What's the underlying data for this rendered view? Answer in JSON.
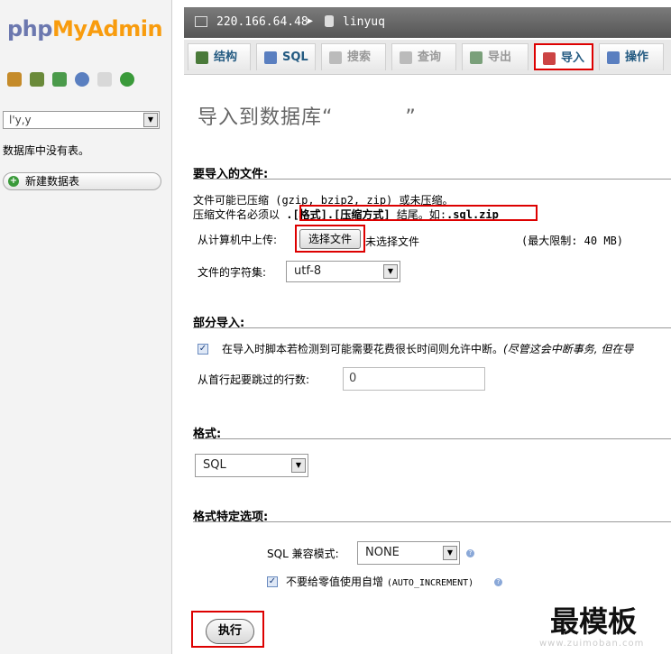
{
  "logo": {
    "part1": "php",
    "part2": "MyAdmin"
  },
  "sidebar": {
    "icons": [
      {
        "name": "home-icon",
        "color": "#c58b2a"
      },
      {
        "name": "sql-query-icon",
        "color": "#6a8a3a"
      },
      {
        "name": "exit-icon",
        "color": "#4a9a4a"
      },
      {
        "name": "help-icon",
        "color": "#5a7fc0"
      },
      {
        "name": "docs-icon",
        "color": "#c8c8c8"
      },
      {
        "name": "reload-icon",
        "color": "#3a9a3a"
      }
    ],
    "db_selected": "l'y,y",
    "no_tables": "数据库中没有表。",
    "new_table": "新建数据表"
  },
  "breadcrumb": {
    "server": "220.166.64.48",
    "sep": "▶",
    "db": "linyuq"
  },
  "tabs": [
    {
      "label": "结构",
      "color": "#4a7a3a"
    },
    {
      "label": "SQL",
      "color": "#5a7fc0"
    },
    {
      "label": "搜索",
      "color": "#bbb"
    },
    {
      "label": "查询",
      "color": "#bbb"
    },
    {
      "label": "导出",
      "color": "#7aa07a"
    },
    {
      "label": "导入",
      "color": "#c44"
    },
    {
      "label": "操作",
      "color": "#5a7fc0"
    }
  ],
  "page_title": {
    "prefix": "导入到数据库“",
    "suffix": "”"
  },
  "file_section": {
    "heading": "要导入的文件:",
    "line1": "文件可能已压缩 (gzip, bzip2, zip) 或未压缩。",
    "line2_prefix": "压缩文件名必须以 ",
    "line2_fmt": ".[格式].[压缩方式]",
    "line2_mid": " 结尾。如:",
    "line2_ex": ".sql.zip",
    "upload_label": "从计算机中上传:",
    "choose_file": "选择文件",
    "no_file": "未选择文件",
    "max_limit": "(最大限制: 40 MB)",
    "charset_label": "文件的字符集:",
    "charset_value": "utf-8"
  },
  "partial_section": {
    "heading": "部分导入:",
    "interrupt_text": "在导入时脚本若检测到可能需要花费很长时间则允许中断。",
    "interrupt_note": "(尽管这会中断事务, 但在导",
    "skip_label": "从首行起要跳过的行数:",
    "skip_value": "0"
  },
  "format_section": {
    "heading": "格式:",
    "value": "SQL"
  },
  "format_options": {
    "heading": "格式特定选项:",
    "compat_label": "SQL 兼容模式:",
    "compat_value": "NONE",
    "auto_inc_label": "不要给零值使用自增",
    "auto_inc_note": "(AUTO_INCREMENT)"
  },
  "execute": "执行",
  "watermark": {
    "main": "最模板",
    "sub": "www.zuimoban.com"
  }
}
